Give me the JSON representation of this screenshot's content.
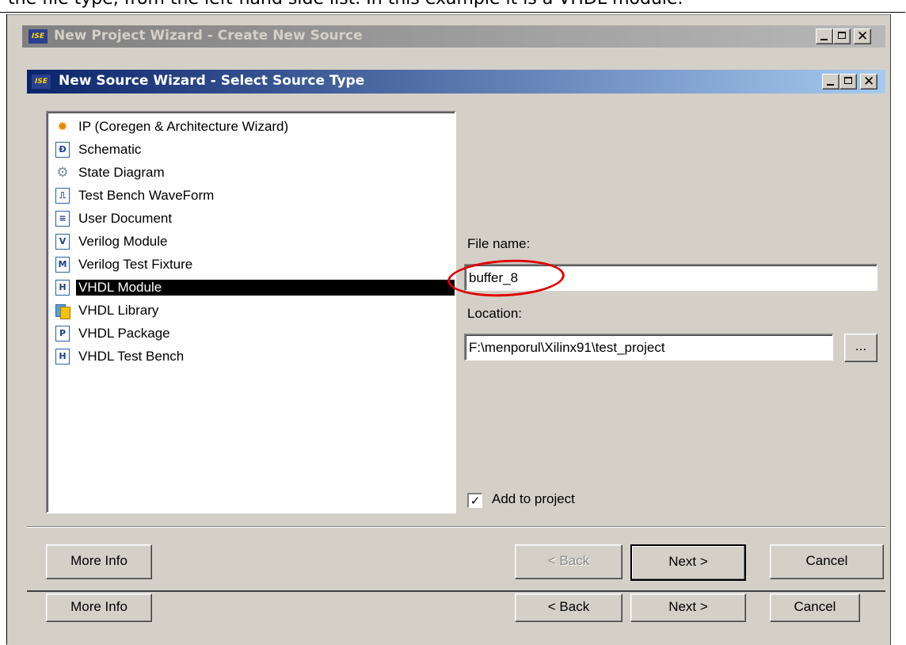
{
  "caption": {
    "text": "the file type, from the left-hand side list. In this example it is a VHDL module."
  },
  "outer_window": {
    "title": "New Project Wizard - Create New Source",
    "logo": "ISE",
    "buttons": {
      "more_info": "More Info",
      "back": "< Back",
      "next": "Next >",
      "cancel": "Cancel"
    }
  },
  "dialog": {
    "title": "New Source Wizard - Select Source Type",
    "logo": "ISE",
    "source_types": [
      {
        "label": "IP (Coregen & Architecture Wizard)",
        "icon": "bulb-icon",
        "glyph": "✹"
      },
      {
        "label": "Schematic",
        "icon": "schematic-icon",
        "glyph": "Ð"
      },
      {
        "label": "State Diagram",
        "icon": "gears-icon",
        "glyph": "⚙"
      },
      {
        "label": "Test Bench WaveForm",
        "icon": "waveform-icon",
        "glyph": "⎍"
      },
      {
        "label": "User Document",
        "icon": "document-icon",
        "glyph": "≡"
      },
      {
        "label": "Verilog Module",
        "icon": "verilog-icon",
        "glyph": "V"
      },
      {
        "label": "Verilog Test Fixture",
        "icon": "verilog-fixture-icon",
        "glyph": "M"
      },
      {
        "label": "VHDL Module",
        "icon": "vhdl-module-icon",
        "glyph": "H"
      },
      {
        "label": "VHDL Library",
        "icon": "library-icon",
        "glyph": ""
      },
      {
        "label": "VHDL Package",
        "icon": "package-icon",
        "glyph": "P"
      },
      {
        "label": "VHDL Test Bench",
        "icon": "vhdl-testbench-icon",
        "glyph": "H"
      }
    ],
    "selected_index": 7,
    "file_name_label": "File name:",
    "file_name_value": "buffer_8",
    "location_label": "Location:",
    "location_value": "F:\\menporul\\Xilinx91\\test_project",
    "browse_label": "...",
    "add_to_project_label": "Add to project",
    "add_to_project_checked": true,
    "checkbox_glyph": "✓",
    "buttons": {
      "more_info": "More Info",
      "back": "< Back",
      "next": "Next >",
      "cancel": "Cancel"
    }
  },
  "title_buttons": {
    "close_glyph": "✕"
  },
  "colors": {
    "active_title": "#0a246a",
    "inactive_title": "#808080",
    "highlight": "#e00000",
    "face": "#d4d0c8"
  }
}
